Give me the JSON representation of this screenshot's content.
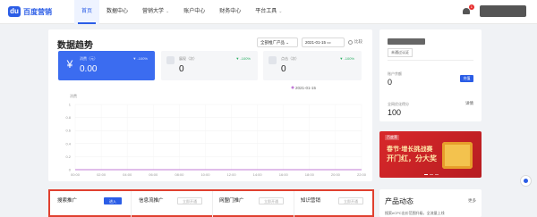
{
  "header": {
    "logo_text": "百度营销",
    "logo_mark": "du",
    "nav": [
      {
        "label": "首页",
        "active": true,
        "caret": false
      },
      {
        "label": "数据中心",
        "active": false,
        "caret": false
      },
      {
        "label": "营销大学",
        "active": false,
        "caret": true
      },
      {
        "label": "账户中心",
        "active": false,
        "caret": false
      },
      {
        "label": "财务中心",
        "active": false,
        "caret": false
      },
      {
        "label": "平台工具",
        "active": false,
        "caret": true
      }
    ],
    "notification_count": "1"
  },
  "trend": {
    "title": "数据趋势",
    "product_select": "全部推广产品",
    "date_select": "2021-01-15",
    "compare_label": "比较",
    "metrics": [
      {
        "label": "消费（元）",
        "value": "0.00",
        "change": "▼ -100%"
      },
      {
        "label": "展现（次）",
        "value": "0",
        "change": "▼ -100%"
      },
      {
        "label": "点击（次）",
        "value": "0",
        "change": "▼ -100%"
      }
    ],
    "legend_date": "2021-01-15"
  },
  "chart_data": {
    "type": "line",
    "ylabel": "消费",
    "y_ticks": [
      "1",
      "0.8",
      "0.6",
      "0.4",
      "0.2",
      "0"
    ],
    "ylim": [
      0,
      1
    ],
    "categories": [
      "00:00",
      "02:00",
      "04:00",
      "06:00",
      "08:00",
      "10:00",
      "12:00",
      "14:00",
      "16:00",
      "18:00",
      "20:00",
      "22:00"
    ],
    "series": [
      {
        "name": "2021-01-15",
        "values": [
          0,
          0,
          0,
          0,
          0,
          0,
          0,
          0,
          0,
          0,
          0,
          0
        ],
        "color": "#c27bd6"
      }
    ],
    "grid": true
  },
  "account": {
    "tag": "未通过认证",
    "balance_label": "账户余额",
    "balance_value": "0",
    "recharge_label": "充值",
    "ops_label": "全网优化得分",
    "ops_value": "100",
    "detail_label": "详情"
  },
  "banner": {
    "brand": "百度营",
    "line1": "春节·增长挑战赛",
    "line2": "开门红，分大奖"
  },
  "quick_tiles": [
    {
      "label": "搜索推广",
      "button": "进入",
      "active": true
    },
    {
      "label": "信息流推广",
      "button": "立即开通",
      "active": false
    },
    {
      "label": "网盟门推广",
      "button": "立即开通",
      "active": false
    },
    {
      "label": "知识营销",
      "button": "立即开通",
      "active": false
    }
  ],
  "product_news": {
    "title": "产品动态",
    "more": "更多",
    "first_item": "搜索eCPC出价范围升级，全流量上线"
  },
  "colors": {
    "brand": "#2b5de6",
    "highlight_border": "#e0402f",
    "banner": "#d8282a"
  }
}
